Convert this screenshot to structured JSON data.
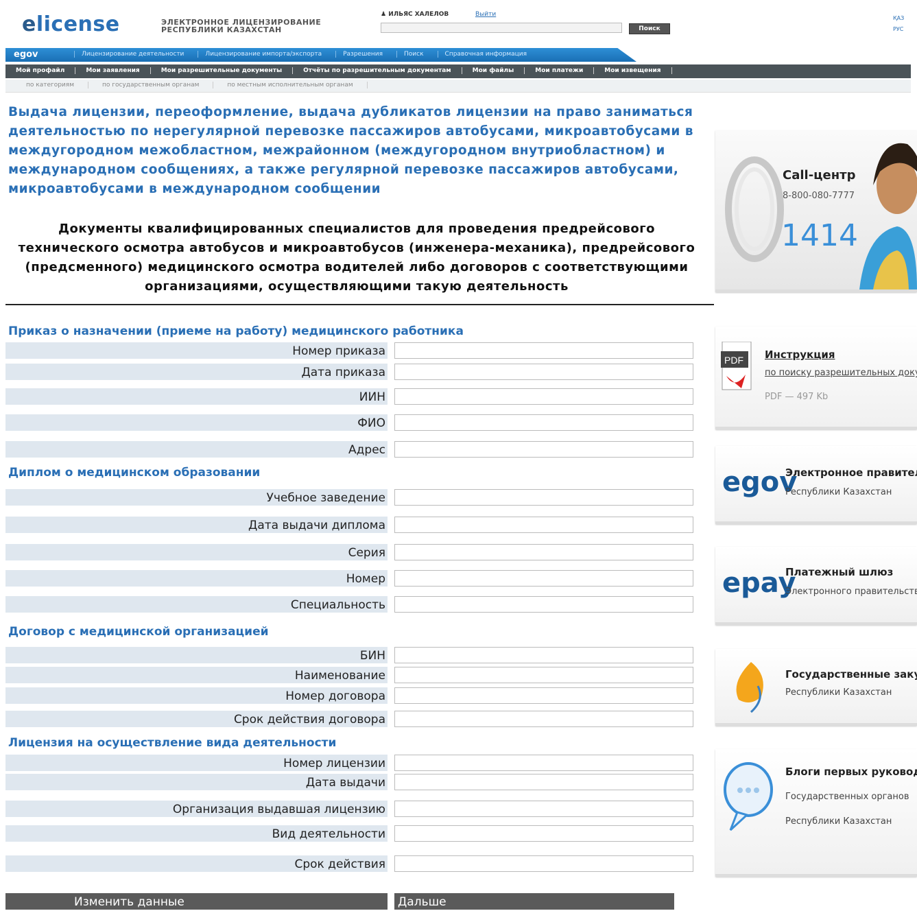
{
  "header": {
    "logo_prefix": "e",
    "logo_suffix": "license",
    "caption": "ЭЛЕКТРОННОЕ ЛИЦЕНЗИРОВАНИЕ РЕСПУБЛИКИ КАЗАХСТАН",
    "user_name": "ИЛЬЯС ХАЛЕЛОВ",
    "logout": "Выйти",
    "search_button": "Поиск",
    "lang_kz": "ҚАЗ",
    "lang_ru": "РУС"
  },
  "nav1": {
    "egov": "egov",
    "items": [
      "Лицензирование деятельности",
      "Лицензирование импорта/экспорта",
      "Разрешения",
      "Поиск",
      "Справочная информация"
    ]
  },
  "nav2": {
    "items": [
      "Мой профайл",
      "Мои заявления",
      "Мои разрешительные документы",
      "Отчёты по разрешительным документам",
      "Мои файлы",
      "Мои платежи",
      "Мои извещения"
    ]
  },
  "nav3": {
    "items": [
      "по категориям",
      "по государственным органам",
      "по местным исполнительным органам"
    ]
  },
  "page": {
    "title": "Выдача лицензии, переоформление, выдача дубликатов лицензии на право заниматься деятельностью по нерегулярной перевозке пассажиров автобусами, микроавтобусами в междугородном межобластном, межрайонном (междугородном внутриобластном) и международном сообщениях, а также регулярной перевозке пассажиров автобусами, микроавтобусами в международном сообщении",
    "docs_heading": "Документы квалифицированных специалистов для проведения предрейсового технического осмотра автобусов и микроавтобусов (инженера-механика), предрейсового (предсменного) медицинского осмотра водителей либо договоров с соответствующими организациями, осуществляющими такую деятельность"
  },
  "form": {
    "sections": [
      "Приказ о назначении (приеме на работу) медицинского работника",
      "Диплом о медицинском образовании",
      "Договор с медицинской организацией",
      "Лицензия на осуществление вида деятельности"
    ],
    "fields": [
      "Номер приказа",
      "Дата приказа",
      "ИИН",
      "ФИО",
      "Адрес",
      "Учебное заведение",
      "Дата выдачи диплома",
      "Серия",
      "Номер",
      "Специальность",
      "БИН",
      "Наименование",
      "Номер договора",
      "Срок действия договора",
      "Номер лицензии",
      "Дата выдачи",
      "Организация выдавшая лицензию",
      "Вид деятельности",
      "Срок действия"
    ],
    "edit_button": "Изменить данные",
    "next_button": "Дальше"
  },
  "sidebar": {
    "call_title": "Call-центр",
    "call_phone": "8-800-080-7777",
    "call_short": "1414",
    "instr_title": "Инструкция",
    "instr_sub": "по поиску разрешительных документов",
    "instr_meta": "PDF — 497 Kb",
    "pdf_label": "PDF",
    "egov_logo": "egov",
    "egov_title": "Электронное правительство",
    "egov_sub": "Республики Казахстан",
    "epay_logo": "epay",
    "epay_title": "Платежный шлюз",
    "epay_sub": "Электронного правительства",
    "gz_title": "Государственные закупки",
    "gz_sub": "Республики Казахстан",
    "blog_title": "Блоги первых руководителей",
    "blog_sub1": "Государственных органов",
    "blog_sub2": "Республики Казахстан"
  }
}
